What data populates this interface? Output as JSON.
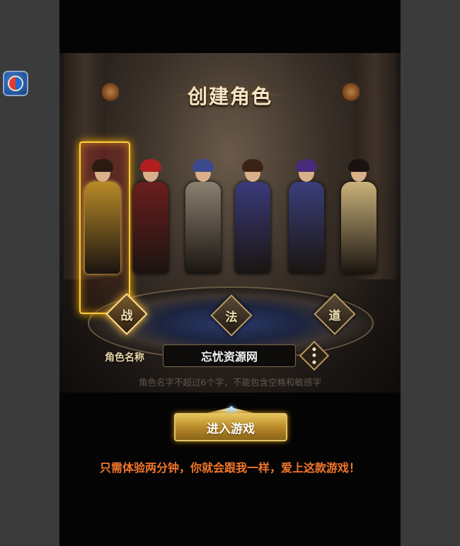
{
  "scene": {
    "title": "创建角色",
    "classes": [
      {
        "label": "战",
        "active": true
      },
      {
        "label": "法",
        "active": false
      },
      {
        "label": "道",
        "active": false
      }
    ],
    "characters": [
      {
        "role": "warrior-male",
        "selected": true,
        "armor": "#b88a28",
        "hair": "#2a1a12"
      },
      {
        "role": "warrior-female",
        "selected": false,
        "armor": "#6a1e1e",
        "hair": "#b01e1e"
      },
      {
        "role": "mage-male",
        "selected": false,
        "armor": "#8a8070",
        "hair": "#3a4a8a"
      },
      {
        "role": "mage-female",
        "selected": false,
        "armor": "#3a3a7a",
        "hair": "#3a2214"
      },
      {
        "role": "taoist-male",
        "selected": false,
        "armor": "#3a3e7a",
        "hair": "#4a2a7a"
      },
      {
        "role": "taoist-female",
        "selected": false,
        "armor": "#c9b27a",
        "hair": "#1a1210"
      }
    ],
    "name_label": "角色名称",
    "name_value": "忘忧资源网",
    "hint": "角色名字不超过6个字，不能包含空格和敏感字"
  },
  "enter_button": "进入游戏",
  "promo": "只需体验两分钟，你就会跟我一样，爱上这款游戏！",
  "colors": {
    "accent_gold": "#ffce4a",
    "promo_orange": "#f2762a",
    "page_bg": "#050405"
  }
}
